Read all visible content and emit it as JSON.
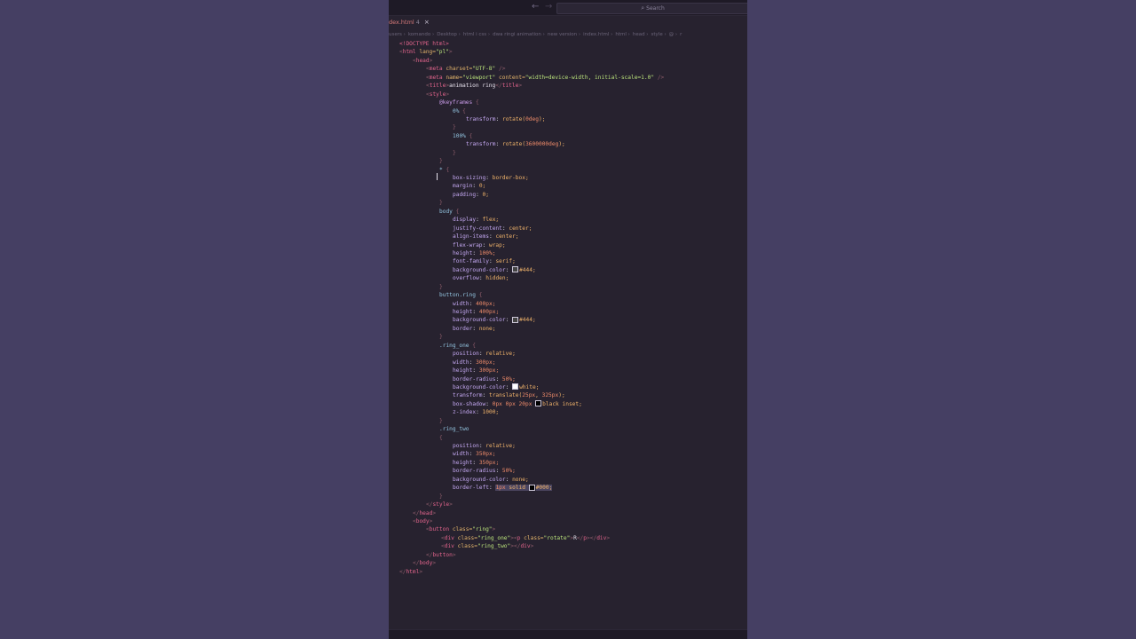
{
  "titlebar": {
    "back_glyph": "←",
    "forward_glyph": "→",
    "search_placeholder": "Search"
  },
  "tab": {
    "label": "dex.html",
    "modified_count": "4",
    "close_glyph": "×"
  },
  "breadcrumb": [
    "users",
    "komando",
    "Desktop",
    "html i css",
    "dwa ringi animation",
    "new version",
    "index.html",
    "html",
    "head",
    "style",
    "@",
    "r"
  ],
  "code_lines": [
    [
      [
        "<!DOCTYPE html>",
        "tk-tag"
      ]
    ],
    [
      [
        "<",
        "tk-punc"
      ],
      [
        "html",
        "tk-tag"
      ],
      [
        " lang=",
        "tk-attr"
      ],
      [
        "\"pl\"",
        "tk-str"
      ],
      [
        ">",
        "tk-punc"
      ]
    ],
    [
      [
        "<",
        "tk-punc"
      ],
      [
        "head",
        "tk-tag"
      ],
      [
        ">",
        "tk-punc"
      ]
    ],
    [
      [
        "<",
        "tk-punc"
      ],
      [
        "meta",
        "tk-tag"
      ],
      [
        " charset=",
        "tk-attr"
      ],
      [
        "\"UTF-8\"",
        "tk-str"
      ],
      [
        " />",
        "tk-punc"
      ]
    ],
    [
      [
        "<",
        "tk-punc"
      ],
      [
        "meta",
        "tk-tag"
      ],
      [
        " name=",
        "tk-attr"
      ],
      [
        "\"viewport\"",
        "tk-str"
      ],
      [
        " content=",
        "tk-attr"
      ],
      [
        "\"width=device-width, initial-scale=1.0\"",
        "tk-str"
      ],
      [
        " />",
        "tk-punc"
      ]
    ],
    [
      [
        "<",
        "tk-punc"
      ],
      [
        "title",
        "tk-tag"
      ],
      [
        ">",
        "tk-punc"
      ],
      [
        "animation ring",
        "tk-text"
      ],
      [
        "</",
        "tk-punc"
      ],
      [
        "title",
        "tk-tag"
      ],
      [
        ">",
        "tk-punc"
      ]
    ],
    [
      [
        "<",
        "tk-punc"
      ],
      [
        "style",
        "tk-tag"
      ],
      [
        ">",
        "tk-punc"
      ]
    ],
    [
      [
        "@keyframes",
        "tk-kw"
      ],
      [
        " {",
        "tk-punc"
      ]
    ],
    [
      [
        "0%",
        "tk-sel"
      ],
      [
        " {",
        "tk-punc"
      ]
    ],
    [
      [
        "transform",
        "tk-prop"
      ],
      [
        ": ",
        "tk-text"
      ],
      [
        "rotate(",
        "tk-val"
      ],
      [
        "0deg",
        "tk-num"
      ],
      [
        ");",
        "tk-val"
      ]
    ],
    [
      [
        "}",
        "tk-punc"
      ]
    ],
    [
      [
        "100%",
        "tk-sel"
      ],
      [
        " {",
        "tk-punc"
      ]
    ],
    [
      [
        "transform",
        "tk-prop"
      ],
      [
        ": ",
        "tk-text"
      ],
      [
        "rotate(",
        "tk-val"
      ],
      [
        "3600000deg",
        "tk-num"
      ],
      [
        ");",
        "tk-val"
      ]
    ],
    [
      [
        "}",
        "tk-punc"
      ]
    ],
    [
      [
        "}",
        "tk-punc"
      ]
    ],
    [
      [
        "*",
        "tk-sel"
      ],
      [
        " {",
        "tk-punc"
      ]
    ],
    [
      [
        "box-sizing",
        "tk-prop"
      ],
      [
        ": ",
        "tk-text"
      ],
      [
        "border-box;",
        "tk-val"
      ]
    ],
    [
      [
        "margin",
        "tk-prop"
      ],
      [
        ": ",
        "tk-text"
      ],
      [
        "0;",
        "tk-val"
      ]
    ],
    [
      [
        "padding",
        "tk-prop"
      ],
      [
        ": ",
        "tk-text"
      ],
      [
        "0;",
        "tk-val"
      ]
    ],
    [
      [
        "}",
        "tk-punc"
      ]
    ],
    [
      [
        "body",
        "tk-sel"
      ],
      [
        " {",
        "tk-punc"
      ]
    ],
    [
      [
        "display",
        "tk-prop"
      ],
      [
        ": ",
        "tk-text"
      ],
      [
        "flex;",
        "tk-val"
      ]
    ],
    [
      [
        "justify-content",
        "tk-prop"
      ],
      [
        ": ",
        "tk-text"
      ],
      [
        "center;",
        "tk-val"
      ]
    ],
    [
      [
        "align-items",
        "tk-prop"
      ],
      [
        ": ",
        "tk-text"
      ],
      [
        "center;",
        "tk-val"
      ]
    ],
    [
      [
        "flex-wrap",
        "tk-prop"
      ],
      [
        ": ",
        "tk-text"
      ],
      [
        "wrap;",
        "tk-val"
      ]
    ],
    [
      [
        "height",
        "tk-prop"
      ],
      [
        ": ",
        "tk-text"
      ],
      [
        "100%;",
        "tk-num"
      ]
    ],
    [
      [
        "font-family",
        "tk-prop"
      ],
      [
        ": ",
        "tk-text"
      ],
      [
        "serif;",
        "tk-val"
      ]
    ],
    [
      [
        "background-color",
        "tk-prop"
      ],
      [
        ": ",
        "tk-text"
      ],
      [
        "#swatch:#444444",
        "sw"
      ],
      [
        "#444;",
        "tk-val"
      ]
    ],
    [
      [
        "overflow",
        "tk-prop"
      ],
      [
        ": ",
        "tk-text"
      ],
      [
        "hidden;",
        "tk-val"
      ]
    ],
    [
      [
        "}",
        "tk-punc"
      ]
    ],
    [
      [
        "button.ring",
        "tk-sel"
      ],
      [
        " {",
        "tk-punc"
      ]
    ],
    [
      [
        "width",
        "tk-prop"
      ],
      [
        ": ",
        "tk-text"
      ],
      [
        "400px;",
        "tk-num"
      ]
    ],
    [
      [
        "height",
        "tk-prop"
      ],
      [
        ": ",
        "tk-text"
      ],
      [
        "400px;",
        "tk-num"
      ]
    ],
    [
      [
        "background-color",
        "tk-prop"
      ],
      [
        ": ",
        "tk-text"
      ],
      [
        "#swatch:#444444",
        "sw"
      ],
      [
        "#444;",
        "tk-val"
      ]
    ],
    [
      [
        "border",
        "tk-prop"
      ],
      [
        ": ",
        "tk-text"
      ],
      [
        "none;",
        "tk-val"
      ]
    ],
    [
      [
        "}",
        "tk-punc"
      ]
    ],
    [
      [
        ".ring_one",
        "tk-sel"
      ],
      [
        " {",
        "tk-punc"
      ]
    ],
    [
      [
        "position",
        "tk-prop"
      ],
      [
        ": ",
        "tk-text"
      ],
      [
        "relative;",
        "tk-val"
      ]
    ],
    [
      [
        "width",
        "tk-prop"
      ],
      [
        ": ",
        "tk-text"
      ],
      [
        "300px;",
        "tk-num"
      ]
    ],
    [
      [
        "height",
        "tk-prop"
      ],
      [
        ": ",
        "tk-text"
      ],
      [
        "300px;",
        "tk-num"
      ]
    ],
    [
      [
        "border-radius",
        "tk-prop"
      ],
      [
        ": ",
        "tk-text"
      ],
      [
        "50%;",
        "tk-num"
      ]
    ],
    [
      [
        "background-color",
        "tk-prop"
      ],
      [
        ": ",
        "tk-text"
      ],
      [
        "#swatch:#ffffff",
        "sw"
      ],
      [
        "white;",
        "tk-val"
      ]
    ],
    [
      [
        "transform",
        "tk-prop"
      ],
      [
        ": ",
        "tk-text"
      ],
      [
        "translate(",
        "tk-val"
      ],
      [
        "25px",
        "tk-num"
      ],
      [
        ", ",
        "tk-val"
      ],
      [
        "325px",
        "tk-num"
      ],
      [
        ");",
        "tk-val"
      ]
    ],
    [
      [
        "box-shadow",
        "tk-prop"
      ],
      [
        ": ",
        "tk-text"
      ],
      [
        "0px 0px 20px ",
        "tk-num"
      ],
      [
        "#swatch:#000000",
        "sw"
      ],
      [
        "black inset;",
        "tk-val"
      ]
    ],
    [
      [
        "z-index",
        "tk-prop"
      ],
      [
        ": ",
        "tk-text"
      ],
      [
        "1000;",
        "tk-val"
      ]
    ],
    [
      [
        "}",
        "tk-punc"
      ]
    ],
    [
      [
        ".ring_two",
        "tk-sel"
      ]
    ],
    [
      [
        "{",
        "tk-punc"
      ]
    ],
    [
      [
        "position",
        "tk-prop"
      ],
      [
        ": ",
        "tk-text"
      ],
      [
        "relative;",
        "tk-val"
      ]
    ],
    [
      [
        "width",
        "tk-prop"
      ],
      [
        ": ",
        "tk-text"
      ],
      [
        "350px;",
        "tk-num"
      ]
    ],
    [
      [
        "height",
        "tk-prop"
      ],
      [
        ": ",
        "tk-text"
      ],
      [
        "350px;",
        "tk-num"
      ]
    ],
    [
      [
        "border-radius",
        "tk-prop"
      ],
      [
        ": ",
        "tk-text"
      ],
      [
        "50%;",
        "tk-num"
      ]
    ],
    [
      [
        "background-color",
        "tk-prop"
      ],
      [
        ": ",
        "tk-text"
      ],
      [
        "none;",
        "tk-val"
      ]
    ],
    [
      [
        "border-left",
        "tk-prop"
      ],
      [
        ": ",
        "tk-text"
      ],
      [
        "1px",
        "tk-num hl"
      ],
      [
        " solid ",
        "tk-val hl"
      ],
      [
        "#swatch:#000000",
        "sw"
      ],
      [
        "#000;",
        "tk-val hl"
      ]
    ],
    [
      [
        "}",
        "tk-punc"
      ]
    ],
    [
      [
        "</",
        "tk-punc"
      ],
      [
        "style",
        "tk-tag"
      ],
      [
        ">",
        "tk-punc"
      ]
    ],
    [
      [
        "</",
        "tk-punc"
      ],
      [
        "head",
        "tk-tag"
      ],
      [
        ">",
        "tk-punc"
      ]
    ],
    [
      [
        "<",
        "tk-punc"
      ],
      [
        "body",
        "tk-tag"
      ],
      [
        ">",
        "tk-punc"
      ]
    ],
    [
      [
        "<",
        "tk-punc"
      ],
      [
        "button",
        "tk-tag"
      ],
      [
        " class=",
        "tk-attr"
      ],
      [
        "\"ring\"",
        "tk-str"
      ],
      [
        ">",
        "tk-punc"
      ]
    ],
    [
      [
        "<",
        "tk-punc"
      ],
      [
        "div",
        "tk-tag"
      ],
      [
        " class=",
        "tk-attr"
      ],
      [
        "\"ring_one\"",
        "tk-str"
      ],
      [
        "><",
        "tk-punc"
      ],
      [
        "p",
        "tk-tag"
      ],
      [
        " class=",
        "tk-attr"
      ],
      [
        "\"rotate\"",
        "tk-str"
      ],
      [
        ">",
        "tk-punc"
      ],
      [
        "R",
        "tk-text"
      ],
      [
        "</",
        "tk-punc"
      ],
      [
        "p",
        "tk-tag"
      ],
      [
        "></",
        "tk-punc"
      ],
      [
        "div",
        "tk-tag"
      ],
      [
        ">",
        "tk-punc"
      ]
    ],
    [
      [
        "<",
        "tk-punc"
      ],
      [
        "div",
        "tk-tag"
      ],
      [
        " class=",
        "tk-attr"
      ],
      [
        "\"ring_two\"",
        "tk-str"
      ],
      [
        "></",
        "tk-punc"
      ],
      [
        "div",
        "tk-tag"
      ],
      [
        ">",
        "tk-punc"
      ]
    ],
    [
      [
        "</",
        "tk-punc"
      ],
      [
        "button",
        "tk-tag"
      ],
      [
        ">",
        "tk-punc"
      ]
    ],
    [
      [
        "</",
        "tk-punc"
      ],
      [
        "body",
        "tk-tag"
      ],
      [
        ">",
        "tk-punc"
      ]
    ],
    [
      [
        "</",
        "tk-punc"
      ],
      [
        "html",
        "tk-tag"
      ],
      [
        ">",
        "tk-punc"
      ]
    ]
  ],
  "colors": {
    "backdrop": "#453f63",
    "editor_bg": "#27222f",
    "tag": "#e2648c",
    "string": "#b8e07a",
    "property": "#c3a7f0",
    "value": "#f0b36a",
    "selector": "#93c5e0"
  }
}
